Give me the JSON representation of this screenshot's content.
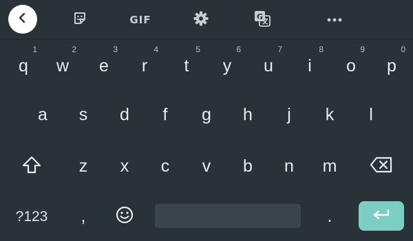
{
  "toolbar": {
    "items": [
      {
        "name": "back-button",
        "icon": "chevron-left-icon"
      },
      {
        "name": "sticker-button",
        "icon": "sticker-icon"
      },
      {
        "name": "gif-button",
        "label": "GIF"
      },
      {
        "name": "settings-button",
        "icon": "gear-icon"
      },
      {
        "name": "translate-button",
        "icon": "translate-icon"
      },
      {
        "name": "more-button",
        "icon": "more-horizontal-icon"
      }
    ]
  },
  "keyboard": {
    "row1": [
      {
        "key": "q",
        "hint": "1"
      },
      {
        "key": "w",
        "hint": "2"
      },
      {
        "key": "e",
        "hint": "3"
      },
      {
        "key": "r",
        "hint": "4"
      },
      {
        "key": "t",
        "hint": "5"
      },
      {
        "key": "y",
        "hint": "6"
      },
      {
        "key": "u",
        "hint": "7"
      },
      {
        "key": "i",
        "hint": "8"
      },
      {
        "key": "o",
        "hint": "9"
      },
      {
        "key": "p",
        "hint": "0"
      }
    ],
    "row2": [
      "a",
      "s",
      "d",
      "f",
      "g",
      "h",
      "j",
      "k",
      "l"
    ],
    "row3": [
      "z",
      "x",
      "c",
      "v",
      "b",
      "n",
      "m"
    ],
    "row3_icons": {
      "shift": "shift-arrow-icon",
      "backspace": "backspace-icon"
    },
    "bottom": {
      "symbols_label": "?123",
      "comma": ",",
      "emoji_icon": "smiley-icon",
      "period": ".",
      "enter_icon": "enter-arrow-icon"
    }
  },
  "colors": {
    "background": "#283237",
    "key_text": "#e8eaed",
    "enter_key": "#7ccdc3",
    "space_bar": "#3a454b"
  }
}
